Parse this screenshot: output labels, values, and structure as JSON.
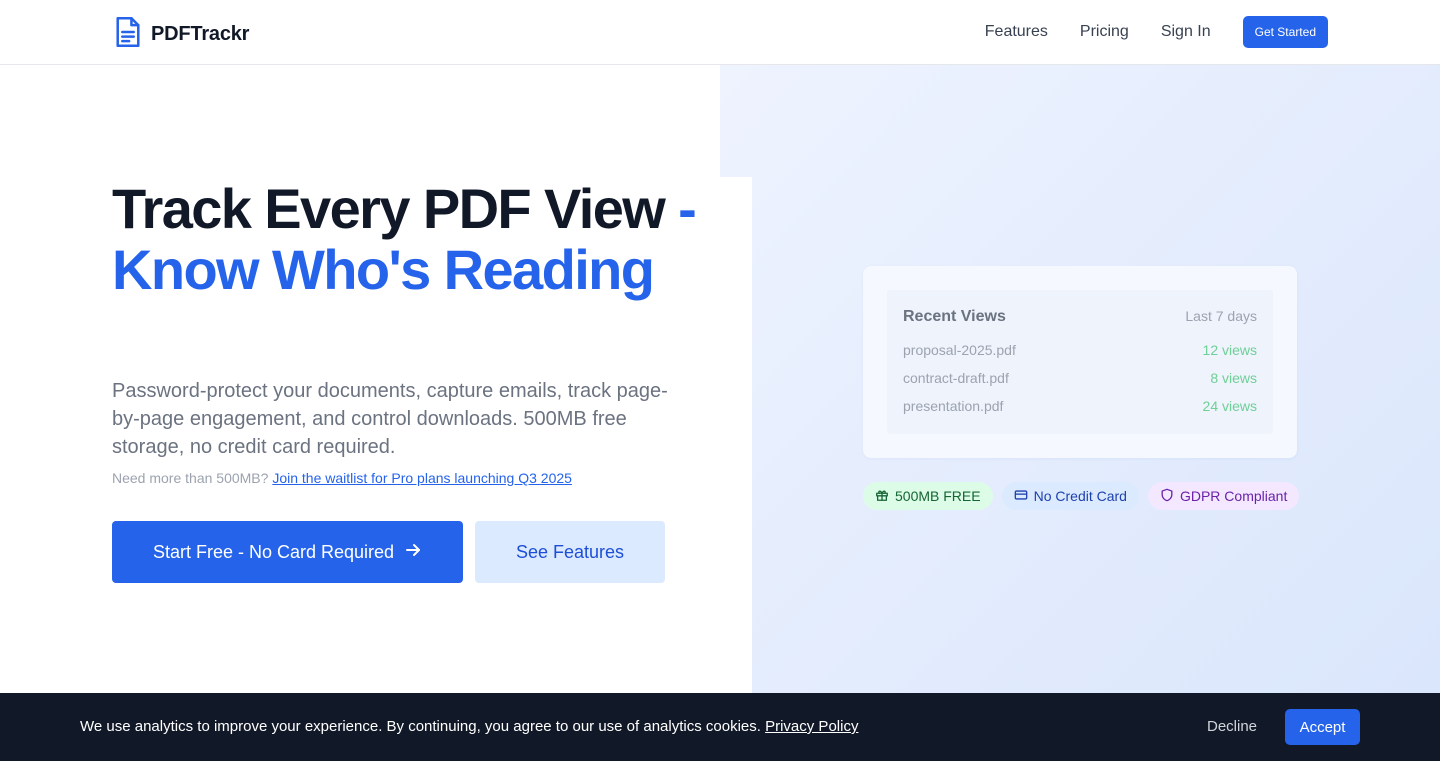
{
  "brand": {
    "name": "PDFTrackr",
    "icon": "document-icon",
    "color": "#2563eb"
  },
  "nav": {
    "links": [
      "Features",
      "Pricing",
      "Sign In"
    ],
    "cta": "Get Started"
  },
  "hero": {
    "headline_dark": "Track Every PDF View",
    "headline_accent": "- Know Who's Reading",
    "subtitle": "Password-protect your documents, capture emails, track page-by-page engagement, and control downloads. 500MB free storage, no credit card required.",
    "waitlist_prefix": "Need more than 500MB?",
    "waitlist_link": "Join the waitlist for Pro plans launching Q3 2025",
    "primary_cta": "Start Free - No Card Required",
    "primary_cta_icon": "arrow-right-icon",
    "secondary_cta": "See Features"
  },
  "recent_views": {
    "title": "Recent Views",
    "range": "Last 7 days",
    "items": [
      {
        "name": "proposal-2025.pdf",
        "views": "12 views"
      },
      {
        "name": "contract-draft.pdf",
        "views": "8 views"
      },
      {
        "name": "presentation.pdf",
        "views": "24 views"
      }
    ]
  },
  "badges": [
    {
      "label": "500MB FREE",
      "icon": "gift-icon",
      "color": "#166534"
    },
    {
      "label": "No Credit Card",
      "icon": "credit-card-icon",
      "color": "#1e40af"
    },
    {
      "label": "GDPR Compliant",
      "icon": "shield-icon",
      "color": "#6b21a8"
    }
  ],
  "cookie": {
    "text": "We use analytics to improve your experience. By continuing, you agree to our use of analytics cookies.",
    "link": "Privacy Policy",
    "decline": "Decline",
    "accept": "Accept"
  }
}
